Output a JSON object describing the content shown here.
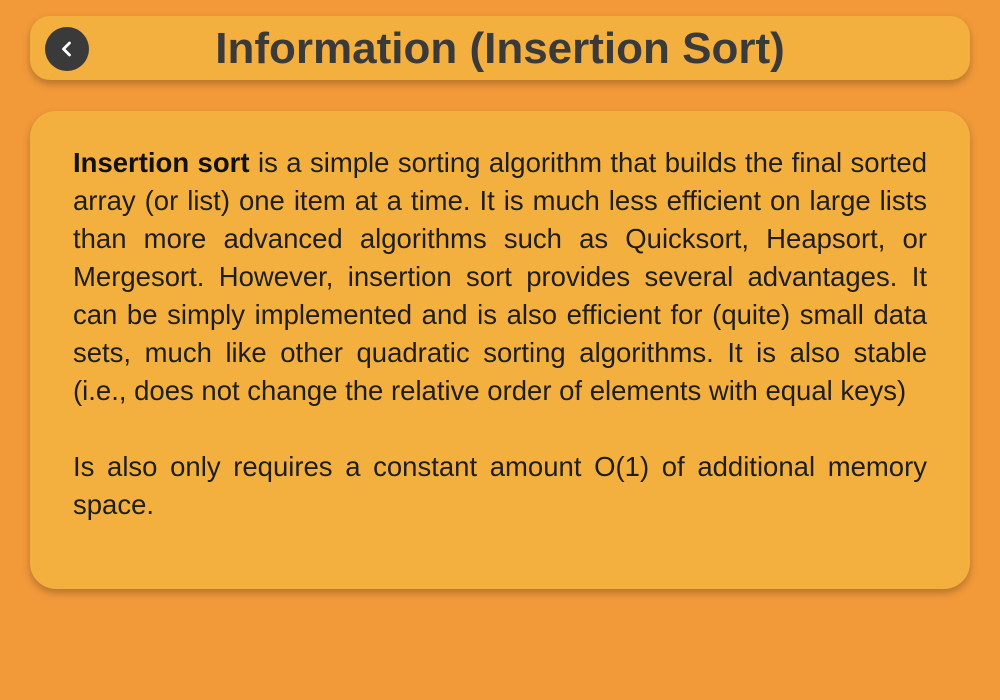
{
  "header": {
    "title": "Information (Insertion Sort)",
    "back_icon": "chevron-left-icon"
  },
  "content": {
    "term": "Insertion sort",
    "paragraph1": " is a simple sorting algorithm that builds the final sorted array (or list) one item at a time. It is much less efficient on large lists than more advanced algorithms such as Quicksort, Heapsort, or Mergesort. However, insertion sort provides several advantages. It can be simply implemented and is also efficient for (quite) small data sets, much like other quadratic sorting algorithms. It is also stable (i.e., does not change the relative order of elements with equal keys)",
    "paragraph2": "Is also only requires a constant amount O(1) of additional memory space."
  },
  "colors": {
    "background": "#F29A3A",
    "panel": "#F3B03E",
    "title_text": "#3a3a3a",
    "back_button": "#3a3a3a"
  }
}
